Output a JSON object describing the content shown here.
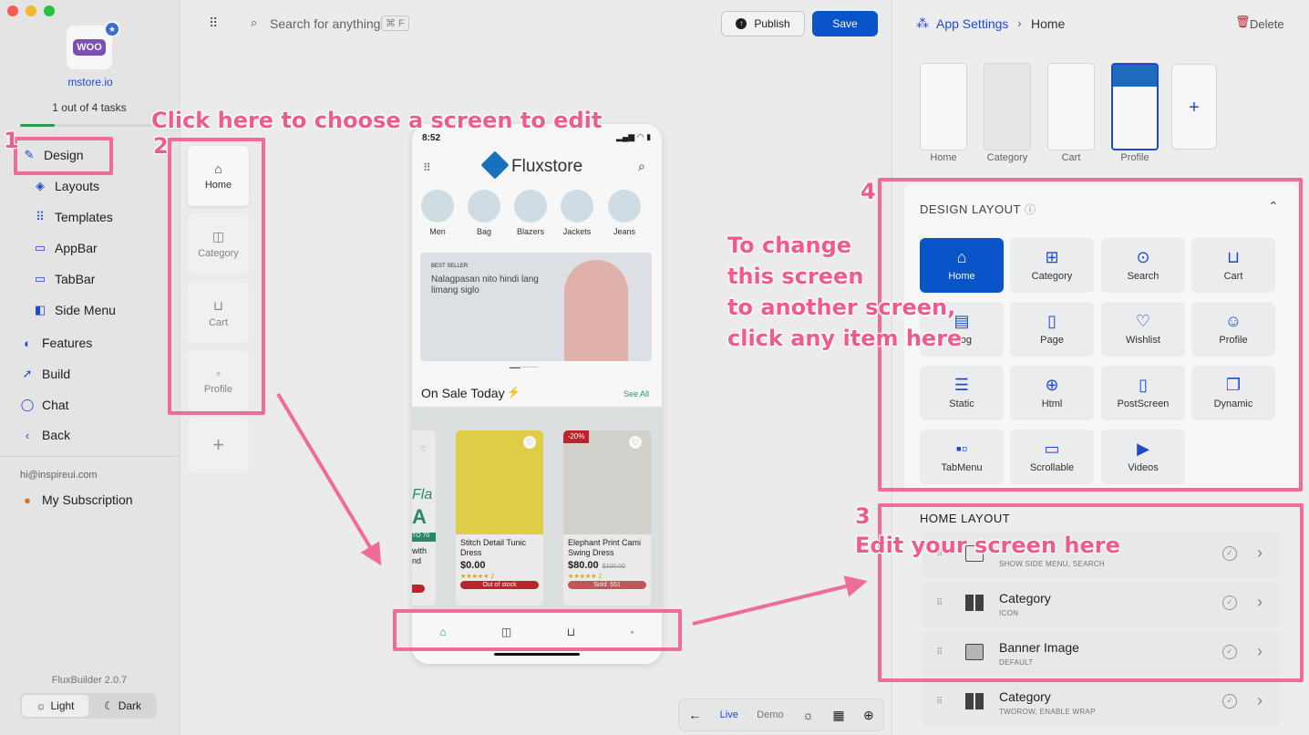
{
  "sidebar": {
    "brand_logo": "WOO",
    "store_name": "mstore.io",
    "tasks": "1 out of 4 tasks",
    "progress": 0.25,
    "items": [
      {
        "label": "Design",
        "icon": "brush-icon"
      },
      {
        "label": "Layouts",
        "icon": "layers-icon"
      },
      {
        "label": "Templates",
        "icon": "grid-icon"
      },
      {
        "label": "AppBar",
        "icon": "appbar-icon"
      },
      {
        "label": "TabBar",
        "icon": "tabbar-icon"
      },
      {
        "label": "Side Menu",
        "icon": "sidemenu-icon"
      },
      {
        "label": "Features",
        "icon": "palette-icon"
      },
      {
        "label": "Build",
        "icon": "rocket-icon"
      },
      {
        "label": "Chat",
        "icon": "chat-icon"
      },
      {
        "label": "Back",
        "icon": "chevron-left-icon"
      }
    ],
    "email": "hi@inspireui.com",
    "subscription": "My Subscription",
    "version": "FluxBuilder 2.0.7",
    "theme_light": "Light",
    "theme_dark": "Dark"
  },
  "topbar": {
    "search_placeholder": "Search for anything",
    "search_shortcut": "⌘ F",
    "publish": "Publish",
    "save": "Save"
  },
  "breadcrumb": {
    "root": "App Settings",
    "current": "Home"
  },
  "delete_label": "Delete",
  "screens": [
    "Home",
    "Category",
    "Cart",
    "Profile"
  ],
  "add_symbol": "+",
  "phone": {
    "time": "8:52",
    "brand": "Fluxstore",
    "categories": [
      "Men",
      "Bag",
      "Blazers",
      "Jackets",
      "Jeans"
    ],
    "banner_tag": "BEST SELLER",
    "banner_text": "Nalagpasan nito hindi lang limang siglo",
    "section_title": "On Sale Today",
    "see_all": "See All",
    "partial_text_a": "Fla",
    "partial_text_b": "A",
    "partial_text_c": "TO 70",
    "partial_name": "with nd",
    "products": [
      {
        "name": "Stitch Detail Tunic Dress",
        "price": "$0.00",
        "old_price": "",
        "reviews": "2",
        "status": "Out of stock",
        "badge": ""
      },
      {
        "name": "Elephant Print Cami Swing Dress",
        "price": "$80.00",
        "old_price": "$100.00",
        "reviews": "2",
        "status": "Sold: 551",
        "badge": "-20%"
      }
    ]
  },
  "bottom_toolbar": {
    "live": "Live",
    "demo": "Demo"
  },
  "right": {
    "thumbs": [
      "Home",
      "Category",
      "Cart",
      "Profile"
    ],
    "design_layout_title": "DESIGN LAYOUT",
    "grid": [
      "Home",
      "Category",
      "Search",
      "Cart",
      "Blog",
      "Page",
      "Wishlist",
      "Profile",
      "Static",
      "Html",
      "PostScreen",
      "Dynamic",
      "TabMenu",
      "Scrollable",
      "Videos"
    ],
    "home_layout_title": "HOME LAYOUT",
    "layout_rows": [
      {
        "title": "",
        "subtitle": "SHOW SIDE MENU, SEARCH"
      },
      {
        "title": "Category",
        "subtitle": "ICON"
      },
      {
        "title": "Banner Image",
        "subtitle": "DEFAULT"
      },
      {
        "title": "Category",
        "subtitle": "TWOROW, ENABLE WRAP"
      }
    ]
  },
  "annotations": {
    "n1": "1",
    "n2": "2",
    "n3": "3",
    "n4": "4",
    "choose": "Click here to choose a screen to edit",
    "change_1": "To change",
    "change_2": "this screen",
    "change_3": "to another screen,",
    "change_4": "click any item here",
    "edit": "Edit your screen here"
  },
  "colors": {
    "accent": "#0b57d0",
    "annotation": "#ef5b8c",
    "sale": "#c2262e"
  }
}
